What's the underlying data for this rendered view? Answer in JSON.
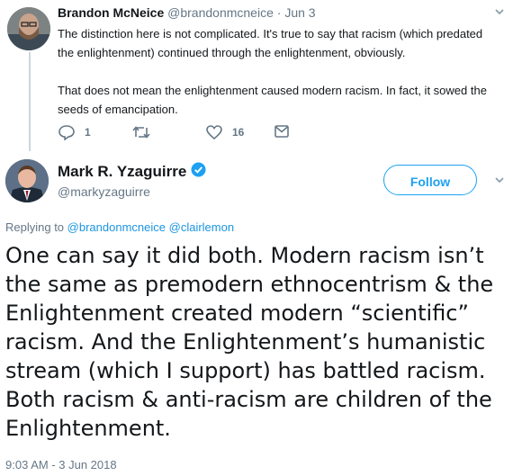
{
  "tweet1": {
    "name": "Brandon McNeice",
    "handle": "@brandonmcneice",
    "separator": "·",
    "date": "Jun 3",
    "paragraph1": "The distinction here is not complicated. It's true to say that racism (which predated the enlightenment) continued through the enlightenment, obviously.",
    "paragraph2": "That does not mean the enlightenment caused modern racism. In fact, it sowed the seeds of emancipation.",
    "reply_count": "1",
    "retweet_count": "",
    "like_count": "16"
  },
  "tweet2": {
    "name": "Mark R. Yzaguirre",
    "handle": "@markyzaguirre",
    "follow_label": "Follow",
    "replying_prefix": "Replying to",
    "reply_mention1": "@brandonmcneice",
    "reply_mention2": "@clairlemon",
    "text": "One can say it did both. Modern racism isn’t the same as premodern ethnocentrism & the Enlightenment created modern “scientific” racism. And the Enlightenment’s humanistic stream (which I support) has battled racism. Both racism & anti-racism are children of the Enlightenment.",
    "timestamp": "9:03 AM - 3 Jun 2018"
  },
  "colors": {
    "accent": "#1da1f2",
    "link": "#1b95e0",
    "muted": "#657786",
    "text": "#14171a"
  },
  "icons": [
    "reply-icon",
    "retweet-icon",
    "heart-icon",
    "dm-icon",
    "chevron-down-icon",
    "verified-badge-icon"
  ]
}
